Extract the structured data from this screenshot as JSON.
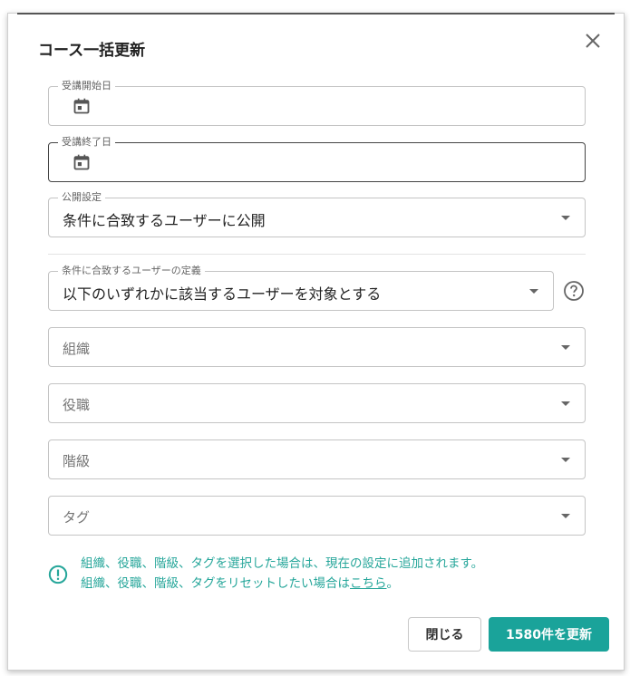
{
  "dialog": {
    "title": "コース一括更新"
  },
  "fields": {
    "start_date": {
      "label": "受講開始日",
      "value": ""
    },
    "end_date": {
      "label": "受講終了日",
      "value": ""
    },
    "visibility": {
      "label": "公開設定",
      "value": "条件に合致するユーザーに公開"
    },
    "user_definition": {
      "label": "条件に合致するユーザーの定義",
      "value": "以下のいずれかに該当するユーザーを対象とする"
    },
    "organization": {
      "placeholder": "組織"
    },
    "position": {
      "placeholder": "役職"
    },
    "grade": {
      "placeholder": "階級"
    },
    "tag": {
      "placeholder": "タグ"
    }
  },
  "info": {
    "line1": "組織、役職、階級、タグを選択した場合は、現在の設定に追加されます。",
    "line2_prefix": "組織、役職、階級、タグをリセットしたい場合は",
    "line2_link": "こちら",
    "line2_suffix": "。"
  },
  "buttons": {
    "close_label": "閉じる",
    "update_label": "1580件を更新"
  },
  "colors": {
    "accent": "#1aa39a",
    "info_text": "#26a69a"
  },
  "icons": {
    "close": "close-icon",
    "calendar": "calendar-icon",
    "caret": "chevron-down-icon",
    "help": "help-circle-icon",
    "info": "info-circle-icon"
  }
}
